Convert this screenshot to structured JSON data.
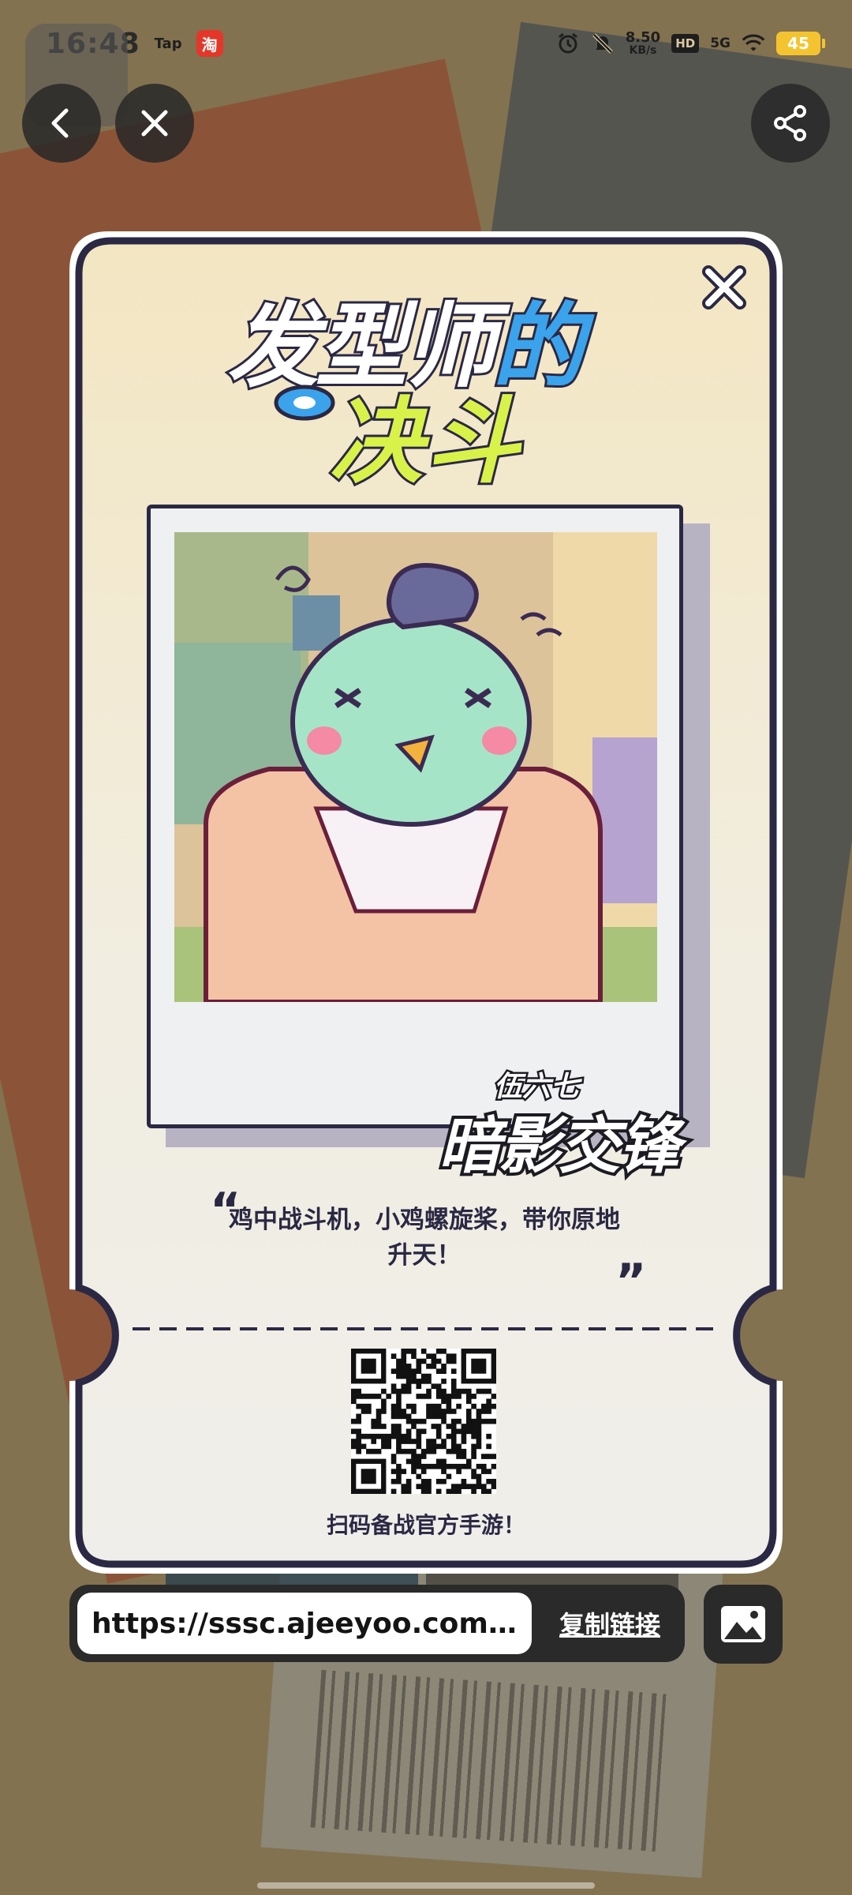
{
  "status_bar": {
    "time": "16:48",
    "app_label": "Tap",
    "taobao_badge": "淘",
    "net_speed_value": "8.50",
    "net_speed_unit": "KB/s",
    "hd": "HD",
    "network": "5G",
    "battery": "45"
  },
  "nav": {
    "back_icon": "chevron-left-icon",
    "close_icon": "close-icon",
    "share_icon": "share-icon"
  },
  "card": {
    "logo_line1_a": "发型师",
    "logo_line1_b": "的",
    "logo_line2": "决斗",
    "brand_small": "伍六七",
    "brand_big": "暗影交锋",
    "quote": "鸡中战斗机，小鸡螺旋桨，带你原地升天！",
    "quote_open": "“",
    "quote_close": "”",
    "qr_caption": "扫码备战官方手游！"
  },
  "link_bar": {
    "url": "https://sssc.ajeeyoo.com/h5...",
    "copy_label": "复制链接",
    "image_icon": "image-icon"
  },
  "colors": {
    "card_bg_top": "#f3e8c7",
    "card_bg_bottom": "#efeeea",
    "outline": "#2b2844",
    "logo_yellow": "#d9f24a",
    "logo_blue": "#3aa3ec",
    "bar_bg": "#2a2a2a"
  }
}
